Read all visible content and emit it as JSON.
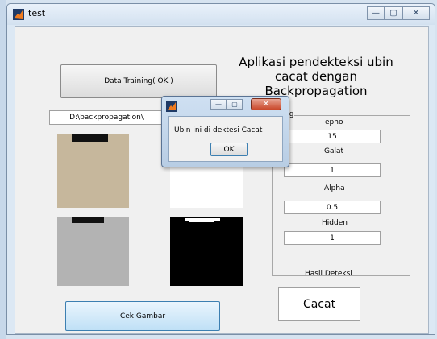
{
  "window": {
    "title": "test",
    "controls": {
      "minimize": "—",
      "maximize": "▢",
      "close": "✕"
    }
  },
  "heading": "Aplikasi pendekteksi ubin cacat dengan Backpropagation",
  "buttons": {
    "data_training": "Data Training( OK )",
    "cek_gambar": "Cek Gambar"
  },
  "path_field": "D:\\backpropagation\\",
  "panel": {
    "title": "ng",
    "epho_label": "epho",
    "epho_value": "15",
    "galat_label": "Galat",
    "galat_value": "1",
    "alpha_label": "Alpha",
    "alpha_value": "0.5",
    "hidden_label": "Hidden",
    "hidden_value": "1"
  },
  "result": {
    "label": "Hasil Deteksi",
    "value": "Cacat"
  },
  "dialog": {
    "message": "Ubin ini di dektesi Cacat",
    "ok_label": "OK"
  },
  "colors": {
    "tile_photo": "#c6b79c",
    "tile_gray": "#b3b3b3",
    "mask_black": "#000000",
    "accent_blue": "#3c7fb1"
  }
}
